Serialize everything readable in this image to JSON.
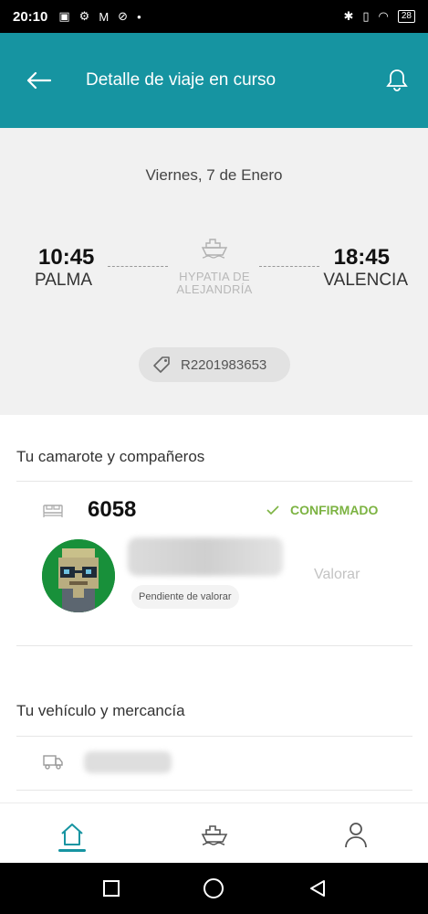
{
  "status_bar": {
    "time": "20:10",
    "battery": "28"
  },
  "header": {
    "title": "Detalle de viaje en curso"
  },
  "trip": {
    "date": "Viernes, 7 de Enero",
    "departure_time": "10:45",
    "departure_port": "PALMA",
    "arrival_time": "18:45",
    "arrival_port": "VALENCIA",
    "ship_name": "HYPATIA DE ALEJANDRÍA",
    "booking_code": "R2201983653"
  },
  "cabin_section": {
    "title": "Tu camarote y compañeros",
    "cabin_number": "6058",
    "status": "CONFIRMADO",
    "pending_label": "Pendiente de valorar",
    "rate_label": "Valorar"
  },
  "vehicle_section": {
    "title": "Tu vehículo y mercancía"
  },
  "colors": {
    "primary": "#1694a1",
    "confirmed": "#7cb342",
    "panel": "#f1f1f1"
  },
  "icons": [
    "back-arrow-icon",
    "bell-icon",
    "ship-icon",
    "tag-icon",
    "bed-icon",
    "check-icon",
    "truck-icon",
    "home-icon",
    "user-icon"
  ]
}
